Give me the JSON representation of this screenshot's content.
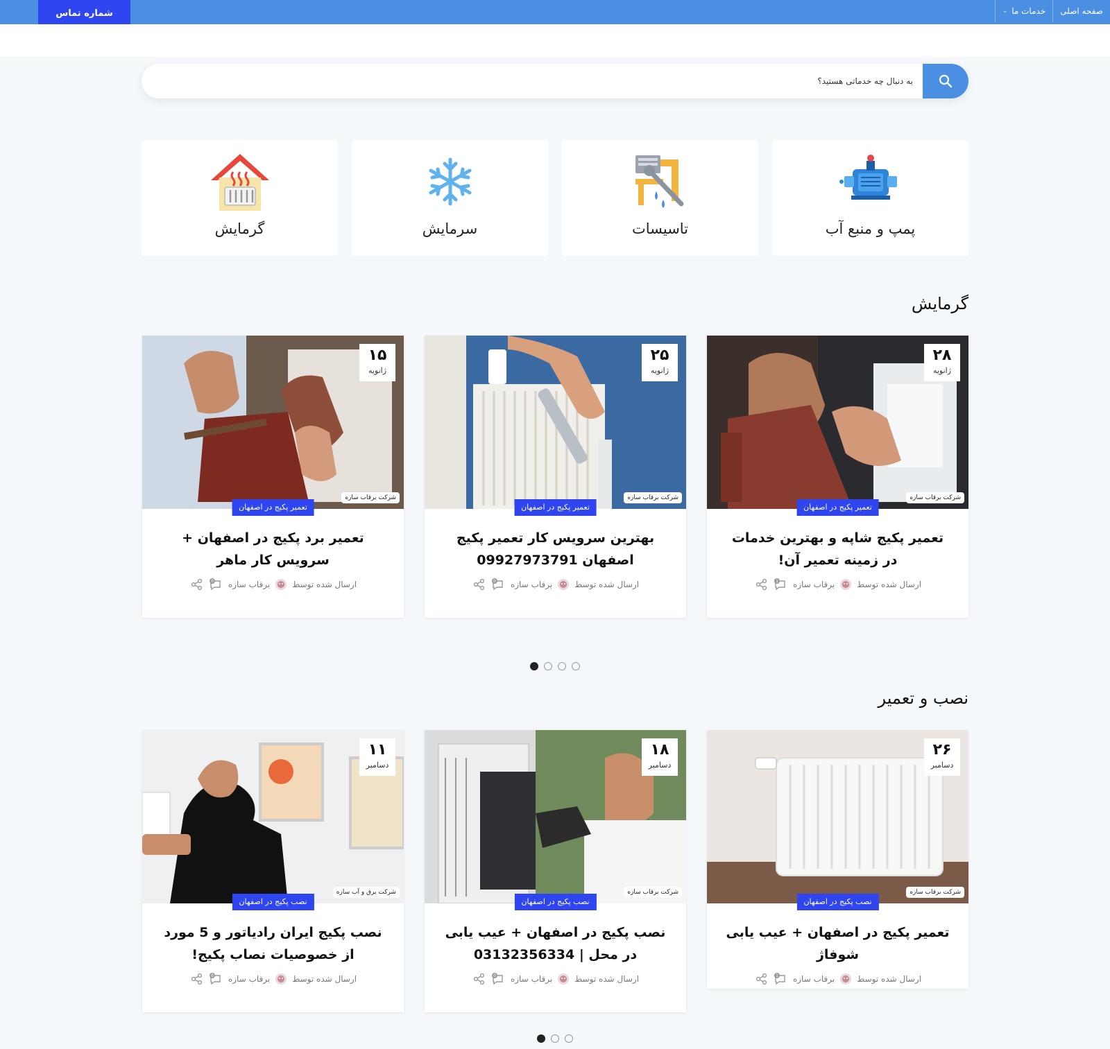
{
  "nav": {
    "home": "صفحه اصلی",
    "services": "خدمات ما",
    "contact_button": "شماره تماس"
  },
  "search": {
    "placeholder": "به دنبال چه خدماتی هستید؟"
  },
  "categories": [
    {
      "label": "پمپ و منبع آب",
      "icon": "water-pump-icon"
    },
    {
      "label": "تاسیسات",
      "icon": "plumbing-tools-icon"
    },
    {
      "label": "سرمایش",
      "icon": "snowflake-icon"
    },
    {
      "label": "گرمایش",
      "icon": "house-radiator-icon"
    }
  ],
  "sections": [
    {
      "title": "گرمایش",
      "posts": [
        {
          "day": "۲۸",
          "month": "ژانویه",
          "tag": "تعمیر پکیج در اصفهان",
          "title": "تعمیر پکیج شاپه و بهترین خدمات در زمینه تعمیر آن!",
          "meta_prefix": "ارسال شده توسط",
          "author": "برقاب سازه",
          "watermark": "شرکت برقاب سازه",
          "comments": "1"
        },
        {
          "day": "۲۵",
          "month": "ژانویه",
          "tag": "تعمیر پکیج در اصفهان",
          "title": "بهترین سرویس کار تعمیر پکیج اصفهان 09927973791",
          "meta_prefix": "ارسال شده توسط",
          "author": "برقاب سازه",
          "watermark": "شرکت برقاب سازه",
          "comments": "0"
        },
        {
          "day": "۱۵",
          "month": "ژانویه",
          "tag": "تعمیر پکیج در اصفهان",
          "title": "تعمیر برد پکیج در اصفهان + سرویس کار ماهر",
          "meta_prefix": "ارسال شده توسط",
          "author": "برقاب سازه",
          "watermark": "شرکت برقاب سازه",
          "comments": "0"
        }
      ],
      "dots": 4
    },
    {
      "title": "نصب و تعمیر",
      "posts": [
        {
          "day": "۲۶",
          "month": "دسامبر",
          "tag": "نصب پکیج در اصفهان",
          "title": "تعمیر پکیج در اصفهان + عیب یابی شوفاژ",
          "meta_prefix": "ارسال شده توسط",
          "author": "برقاب سازه",
          "watermark": "شرکت برقاب سازه",
          "comments": "1"
        },
        {
          "day": "۱۸",
          "month": "دسامبر",
          "tag": "نصب پکیج در اصفهان",
          "title": "نصب پکیج در اصفهان + عیب یابی در محل | 03132356334",
          "meta_prefix": "ارسال شده توسط",
          "author": "برقاب سازه",
          "watermark": "شرکت برقاب سازه",
          "comments": "0"
        },
        {
          "day": "۱۱",
          "month": "دسامبر",
          "tag": "نصب پکیج در اصفهان",
          "title": "نصب پکیج ایران رادیاتور و 5 مورد از خصوصیات نصاب پکیج!",
          "meta_prefix": "ارسال شده توسط",
          "author": "برقاب سازه",
          "watermark": "شرکت برق و آب سازه",
          "comments": "0"
        }
      ],
      "dots": 3
    }
  ],
  "colors": {
    "topbar": "#4a8fe2",
    "accent": "#2f45f0",
    "background": "#f5f8fb"
  }
}
